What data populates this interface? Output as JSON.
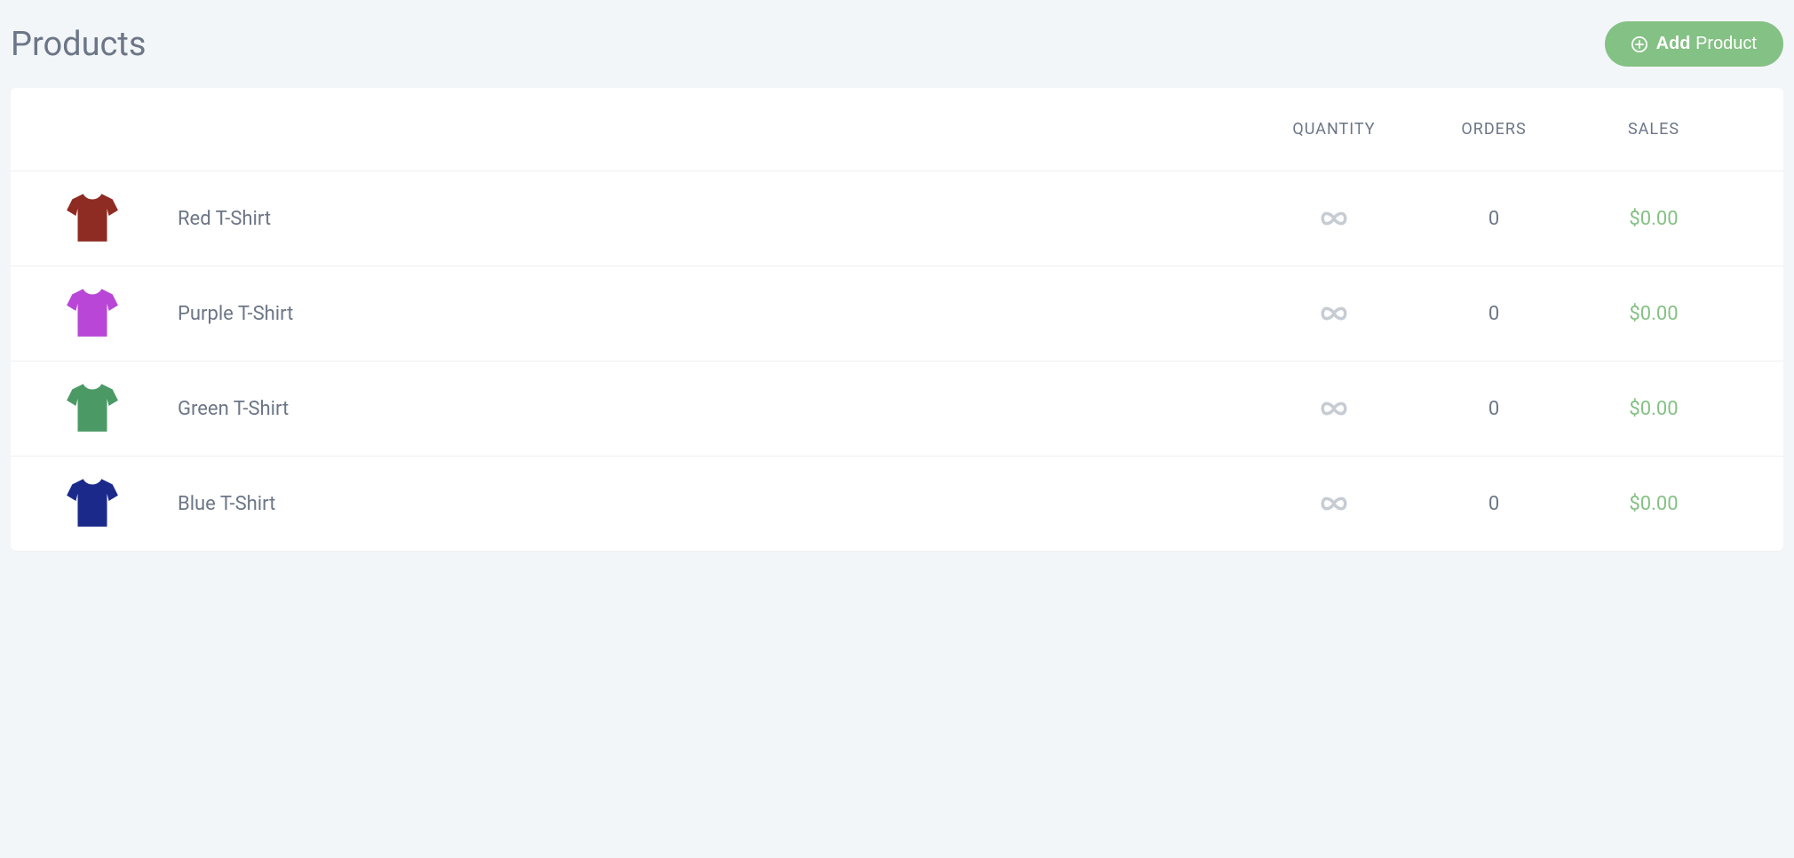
{
  "header": {
    "title": "Products",
    "add_button_strong": "Add",
    "add_button_light": "Product"
  },
  "table": {
    "columns": {
      "name": "",
      "quantity": "QUANTITY",
      "orders": "ORDERS",
      "sales": "SALES"
    },
    "rows": [
      {
        "name": "Red T-Shirt",
        "color": "#8e2b22",
        "quantity": "∞",
        "orders": "0",
        "sales": "$0.00"
      },
      {
        "name": "Purple T-Shirt",
        "color": "#b946d6",
        "quantity": "∞",
        "orders": "0",
        "sales": "$0.00"
      },
      {
        "name": "Green T-Shirt",
        "color": "#4b9a66",
        "quantity": "∞",
        "orders": "0",
        "sales": "$0.00"
      },
      {
        "name": "Blue T-Shirt",
        "color": "#1b2a8a",
        "quantity": "∞",
        "orders": "0",
        "sales": "$0.00"
      }
    ]
  }
}
